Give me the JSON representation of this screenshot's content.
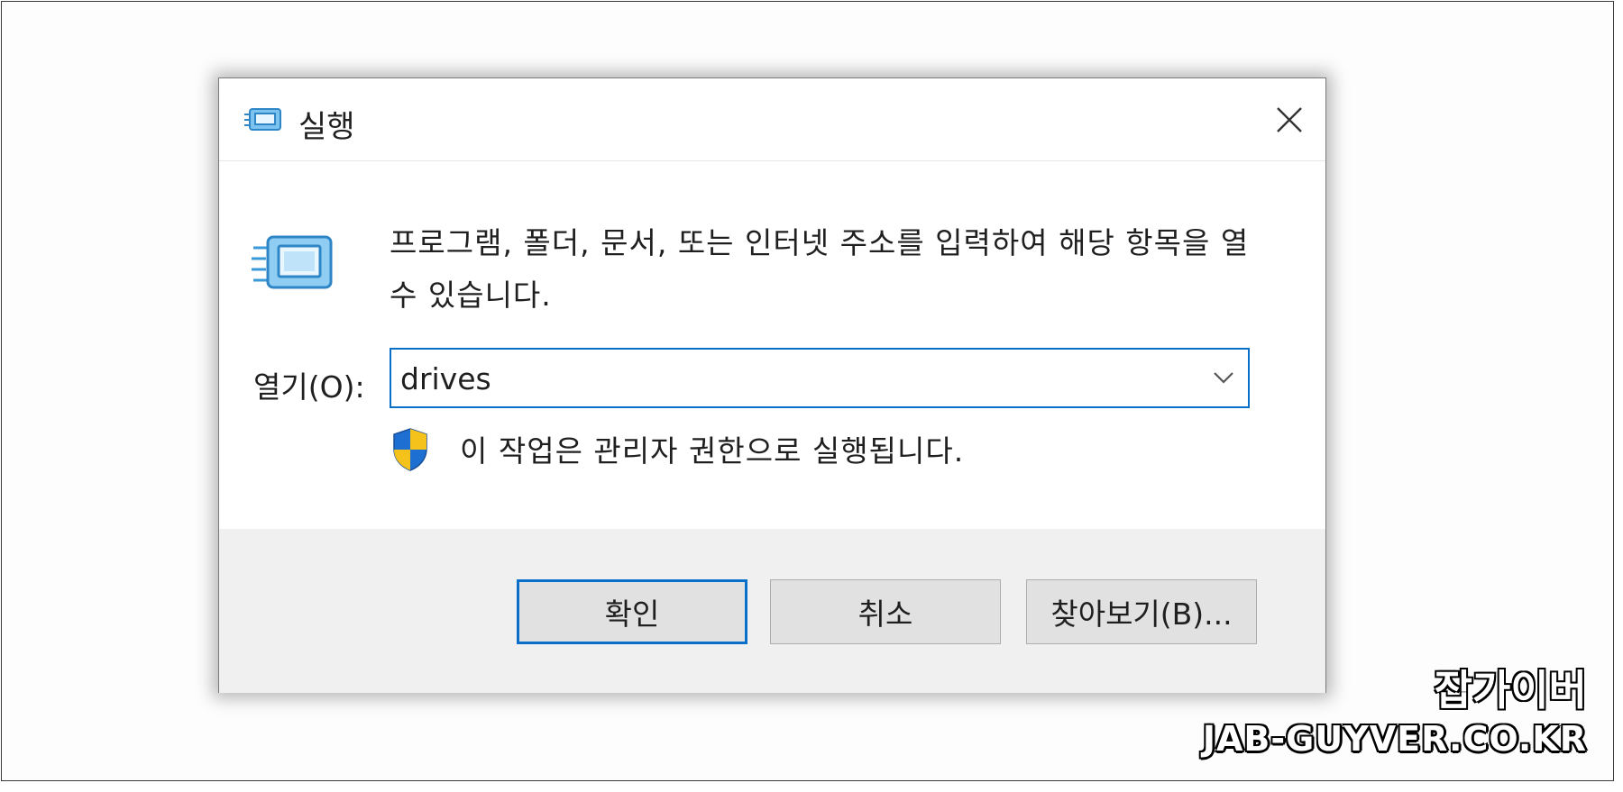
{
  "window": {
    "title": "실행",
    "icon": "run-icon",
    "close_icon": "close-icon"
  },
  "body": {
    "description": "프로그램, 폴더, 문서, 또는 인터넷 주소를 입력하여 해당 항목을 열 수 있습니다.",
    "open_label": "열기(O):",
    "open_value": "drives",
    "admin_note": "이 작업은 관리자 권한으로 실행됩니다."
  },
  "buttons": {
    "ok": "확인",
    "cancel": "취소",
    "browse": "찾아보기(B)..."
  },
  "watermark": {
    "name": "잡가이버",
    "url": "JAB-GUYVER.CO.KR"
  },
  "colors": {
    "accent": "#0a6fc9",
    "footer_bg": "#f0f0f0",
    "button_bg": "#e1e1e1"
  }
}
